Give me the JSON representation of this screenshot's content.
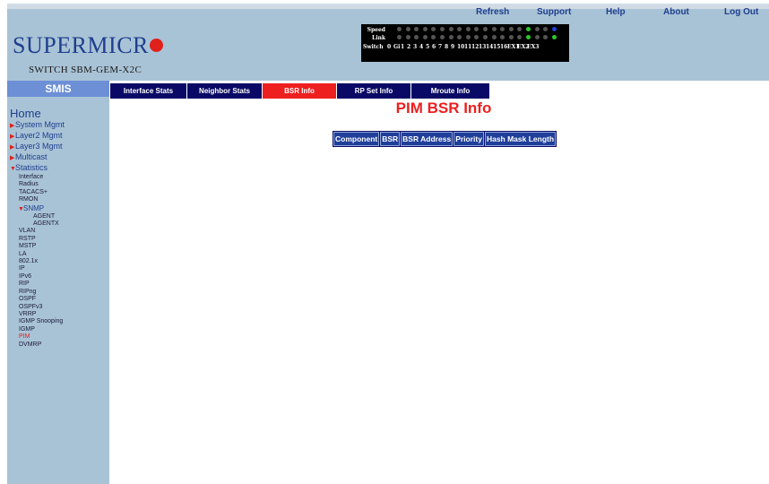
{
  "header": {
    "logo_text": "SUPERMICR",
    "switch_name": "SWITCH SBM-GEM-X2C",
    "nav": [
      "Refresh",
      "Support",
      "Help",
      "About",
      "Log Out"
    ]
  },
  "port_panel": {
    "speed_label": "Speed",
    "link_label": "Link",
    "switch_label": "Switch",
    "port_numbers": [
      "0",
      "Gi",
      "1",
      "2",
      "3",
      "4",
      "5",
      "6",
      "7",
      "8",
      "9",
      "10",
      "11",
      "12",
      "13",
      "14",
      "15",
      "16",
      "EX1",
      "EX2",
      "EX3"
    ]
  },
  "sidebar": {
    "title": "SMIS",
    "home": "Home",
    "menus": [
      "System Mgmt",
      "Layer2 Mgmt",
      "Layer3 Mgmt",
      "Multicast",
      "Statistics"
    ],
    "stats_items_top": [
      "Interface",
      "Radius",
      "TACACS+",
      "RMON"
    ],
    "snmp_label": "SNMP",
    "snmp_items": [
      "AGENT",
      "AGENTX"
    ],
    "stats_items_bottom": [
      "VLAN",
      "RSTP",
      "MSTP",
      "LA",
      "802.1x",
      "IP",
      "IPv6",
      "RIP",
      "RIPng",
      "OSPF",
      "OSPFv3",
      "VRRP",
      "IGMP Snooping",
      "IGMP",
      "PIM",
      "DVMRP"
    ],
    "active_item": "PIM"
  },
  "tabs": [
    "Interface Stats",
    "Neighbor Stats",
    "BSR Info",
    "RP Set Info",
    "Mroute Info"
  ],
  "active_tab": "BSR Info",
  "page_title": "PIM BSR Info",
  "table": {
    "columns": [
      "Component",
      "BSR",
      "BSR Address",
      "Priority",
      "Hash Mask Length"
    ]
  },
  "colors": {
    "header_bg": "#a9c3d6",
    "tab_bg": "#0a0a66",
    "active_tab_bg": "#ee1f1f",
    "title_color": "#ee1f1f",
    "link_color": "#1f3f8f"
  }
}
